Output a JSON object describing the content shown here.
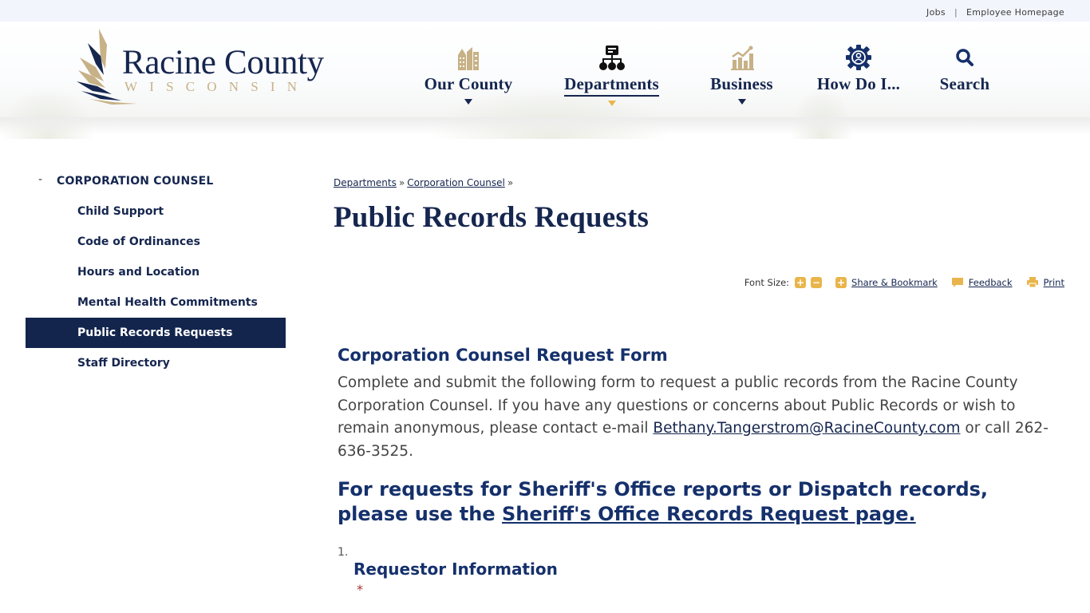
{
  "utility": {
    "links": [
      "Jobs",
      "Employee Homepage"
    ],
    "separator": "|"
  },
  "logo": {
    "title": "Racine County",
    "subtitle": "WISCONSIN"
  },
  "nav": {
    "items": [
      {
        "label": "Our County",
        "icon": "buildings-icon",
        "has_dropdown": true,
        "active": false
      },
      {
        "label": "Departments",
        "icon": "org-chart-icon",
        "has_dropdown": true,
        "active": true
      },
      {
        "label": "Business",
        "icon": "bar-chart-icon",
        "has_dropdown": true,
        "active": false
      },
      {
        "label": "How Do I...",
        "icon": "gear-user-icon",
        "has_dropdown": false,
        "active": false
      },
      {
        "label": "Search",
        "icon": "search-icon",
        "has_dropdown": false,
        "active": false
      }
    ]
  },
  "sidebar": {
    "toggle": "-",
    "heading": "CORPORATION COUNSEL",
    "items": [
      {
        "label": "Child Support",
        "active": false
      },
      {
        "label": "Code of Ordinances",
        "active": false
      },
      {
        "label": "Hours and Location",
        "active": false
      },
      {
        "label": "Mental Health Commitments",
        "active": false
      },
      {
        "label": "Public Records Requests",
        "active": true
      },
      {
        "label": "Staff Directory",
        "active": false
      }
    ]
  },
  "breadcrumb": {
    "items": [
      "Departments",
      "Corporation Counsel"
    ],
    "separator": "»"
  },
  "page": {
    "title": "Public Records Requests"
  },
  "tools": {
    "font_size_label": "Font Size:",
    "increase": "+",
    "decrease": "−",
    "share_icon": "+",
    "share_label": "Share & Bookmark",
    "feedback_label": "Feedback",
    "print_label": "Print"
  },
  "form": {
    "title": "Corporation Counsel Request Form",
    "intro_before": "Complete and submit the following form to request a public records from the Racine County Corporation Counsel. If you have any questions or concerns about Public Records or wish to remain anonymous, please contact e-mail ",
    "email": "Bethany.Tangerstrom@RacineCounty.com",
    "intro_after": " or call 262-636-3525.",
    "sheriff_before": "For requests for Sheriff's Office reports or Dispatch records, please use the ",
    "sheriff_link": "Sheriff's Office Records Request page.",
    "step_number": "1.",
    "step_title": "Requestor Information",
    "required": "*"
  },
  "colors": {
    "navy": "#15264f",
    "gold": "#c7b186",
    "accent": "#e9b54b",
    "active_bg": "#13254d"
  }
}
